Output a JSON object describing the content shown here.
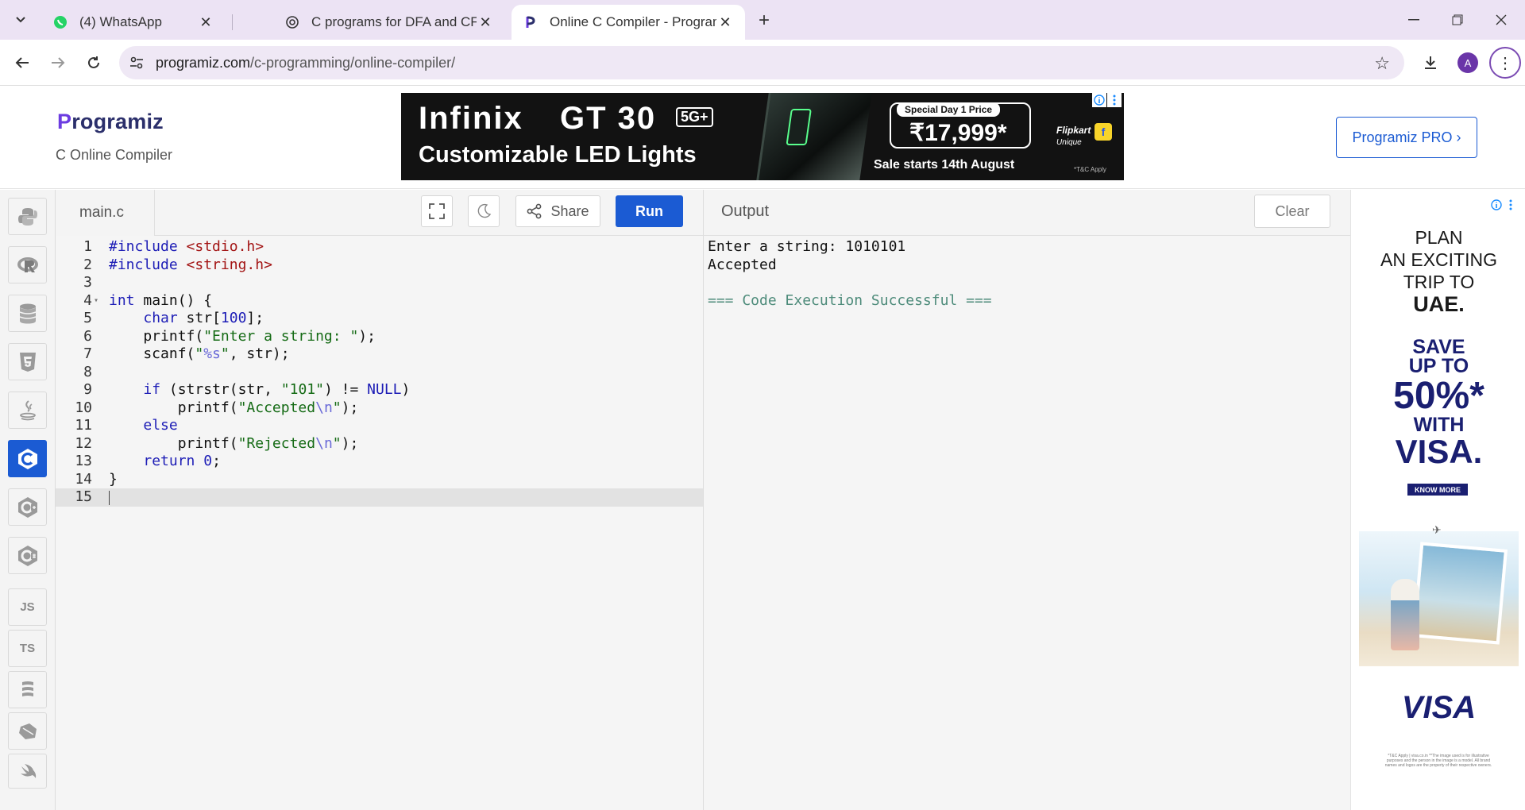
{
  "browser": {
    "tabs": [
      {
        "title": "(4) WhatsApp",
        "icon": "whatsapp-icon"
      },
      {
        "title": "C programs for DFA and CFG",
        "icon": "chatgpt-icon"
      },
      {
        "title": "Online C Compiler - Programiz",
        "icon": "programiz-icon",
        "active": true
      }
    ],
    "url_host": "programiz.com",
    "url_path": "/c-programming/online-compiler/",
    "profile_initial": "A"
  },
  "header": {
    "logo_text": "rogramiz",
    "logo_letter": "P",
    "subtitle": "C Online Compiler",
    "pro_button": "Programiz PRO ›"
  },
  "banner_ad": {
    "brand": "Infinix",
    "model": "GT 30",
    "badge": "5G+",
    "tagline": "Customizable LED Lights",
    "special": "Special Day 1 Price",
    "price": "₹17,999*",
    "sale": "Sale starts 14th August",
    "retailer": "Flipkart",
    "retailer_sub": "Unique",
    "tc": "*T&C Apply"
  },
  "sidebar": {
    "languages": [
      {
        "name": "python-icon",
        "label": ""
      },
      {
        "name": "r-icon",
        "label": ""
      },
      {
        "name": "sql-icon",
        "label": ""
      },
      {
        "name": "html-icon",
        "label": ""
      },
      {
        "name": "java-icon",
        "label": ""
      },
      {
        "name": "c-icon",
        "label": "",
        "active": true
      },
      {
        "name": "cpp-icon",
        "label": ""
      },
      {
        "name": "csharp-icon",
        "label": ""
      },
      {
        "name": "js-icon",
        "label": "JS"
      },
      {
        "name": "ts-icon",
        "label": "TS"
      },
      {
        "name": "go-icon",
        "label": ""
      },
      {
        "name": "php-icon",
        "label": ""
      },
      {
        "name": "swift-icon",
        "label": ""
      }
    ]
  },
  "editor": {
    "filename": "main.c",
    "share_label": "Share",
    "run_label": "Run",
    "current_line": 15,
    "lines": [
      "#include <stdio.h>",
      "#include <string.h>",
      "",
      "int main() {",
      "    char str[100];",
      "    printf(\"Enter a string: \");",
      "    scanf(\"%s\", str);",
      "",
      "    if (strstr(str, \"101\") != NULL)",
      "        printf(\"Accepted\\n\");",
      "    else",
      "        printf(\"Rejected\\n\");",
      "    return 0;",
      "}",
      ""
    ]
  },
  "output": {
    "title": "Output",
    "clear_label": "Clear",
    "lines": [
      "Enter a string: 1010101",
      "Accepted",
      "",
      "=== Code Execution Successful ==="
    ]
  },
  "side_ad": {
    "line1": "PLAN",
    "line2": "AN EXCITING",
    "line3": "TRIP TO",
    "line4": "UAE.",
    "save1": "SAVE",
    "save2": "UP TO",
    "percent": "50%*",
    "with": "WITH",
    "visa": "VISA.",
    "know_more": "KNOW MORE",
    "visa_logo": "VISA",
    "fine_print": "*T&C Apply | visa.co.in  **The image used is for illustrative purposes and the person in the image is a model. All brand names and logos are the property of their respective owners."
  }
}
